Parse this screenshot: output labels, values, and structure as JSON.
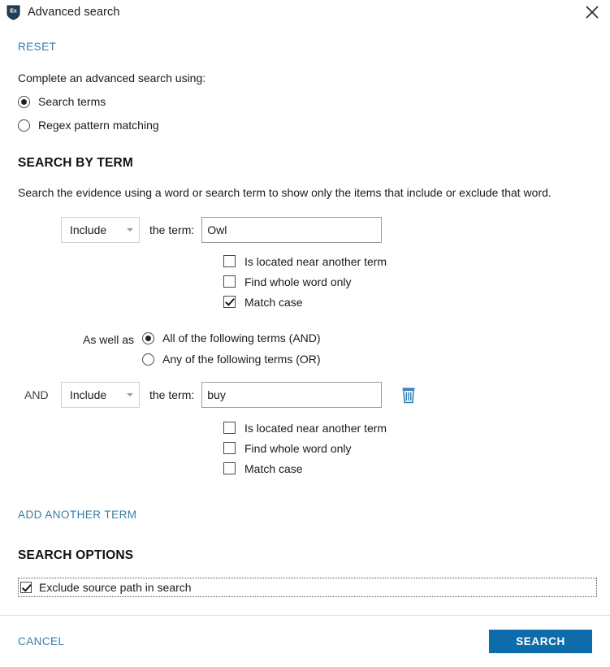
{
  "window": {
    "title": "Advanced search",
    "app_icon": "shield-ex-icon",
    "close_icon": "close-icon"
  },
  "reset": {
    "label": "RESET"
  },
  "intro": {
    "text": "Complete an advanced search using:"
  },
  "mode": {
    "options": [
      {
        "label": "Search terms",
        "checked": true
      },
      {
        "label": "Regex pattern matching",
        "checked": false
      }
    ]
  },
  "search_by_term": {
    "title": "SEARCH BY TERM",
    "description": "Search the evidence using a word or search term to show only the items that include or exclude that word.",
    "the_term_label": "the term:",
    "terms": [
      {
        "conjunction": "",
        "operator": "Include",
        "value": "Owl",
        "options": [
          {
            "label": "Is located near another term",
            "checked": false
          },
          {
            "label": "Find whole word only",
            "checked": false
          },
          {
            "label": "Match case",
            "checked": true
          }
        ]
      },
      {
        "conjunction": "AND",
        "operator": "Include",
        "value": "buy",
        "delete_icon": "trash-icon",
        "options": [
          {
            "label": "Is located near another term",
            "checked": false
          },
          {
            "label": "Find whole word only",
            "checked": false
          },
          {
            "label": "Match case",
            "checked": false
          }
        ]
      }
    ],
    "combiner": {
      "label": "As well as",
      "options": [
        {
          "label": "All of the following terms (AND)",
          "checked": true
        },
        {
          "label": "Any of the following terms (OR)",
          "checked": false
        }
      ]
    },
    "add_another_term": "ADD ANOTHER TERM"
  },
  "search_options": {
    "title": "SEARCH OPTIONS",
    "exclude_source_path": {
      "label": "Exclude source path in search",
      "checked": true
    }
  },
  "footer": {
    "cancel_label": "CANCEL",
    "search_label": "SEARCH"
  },
  "colors": {
    "link": "#3a7ca5",
    "primary_button": "#0f6cab",
    "icon_blue": "#2b7cb3",
    "title_icon_navy": "#1e3a52"
  }
}
